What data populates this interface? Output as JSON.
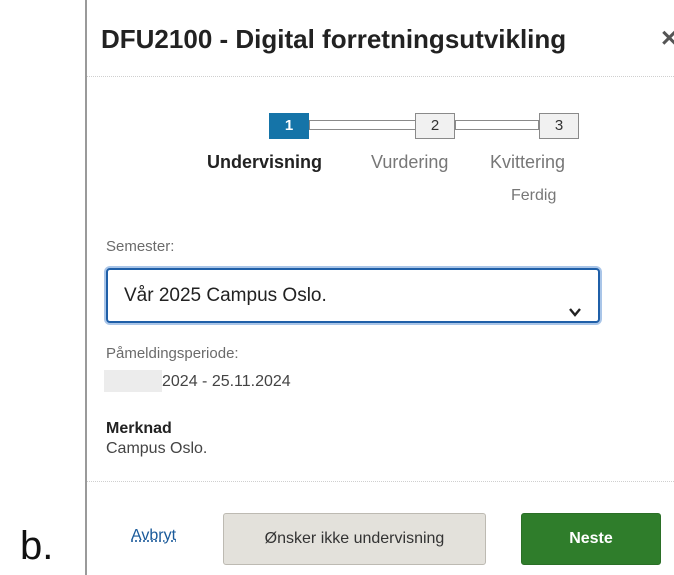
{
  "outer_label": "b.",
  "modal": {
    "title": "DFU2100 - Digital forretningsutvikling",
    "close_symbol": "×"
  },
  "steps": [
    {
      "number": "1",
      "label": "Undervisning",
      "active": true
    },
    {
      "number": "2",
      "label": "Vurdering",
      "active": false
    },
    {
      "number": "3",
      "label": "Kvittering",
      "sub": "Ferdig",
      "active": false
    }
  ],
  "semester": {
    "label": "Semester:",
    "selected": "Vår 2025 Campus Oslo.",
    "icon": "chevron-down-icon"
  },
  "period": {
    "label": "Påmeldingsperiode:",
    "value": "2024 - 25.11.2024"
  },
  "note": {
    "label": "Merknad",
    "value": "Campus Oslo."
  },
  "footer": {
    "cancel_label": "Avbryt",
    "decline_label": "Ønsker ikke undervisning",
    "next_label": "Neste"
  },
  "colors": {
    "active_step": "#1574a8",
    "primary_button": "#2f7d2b",
    "select_border": "#1f5fa8"
  }
}
